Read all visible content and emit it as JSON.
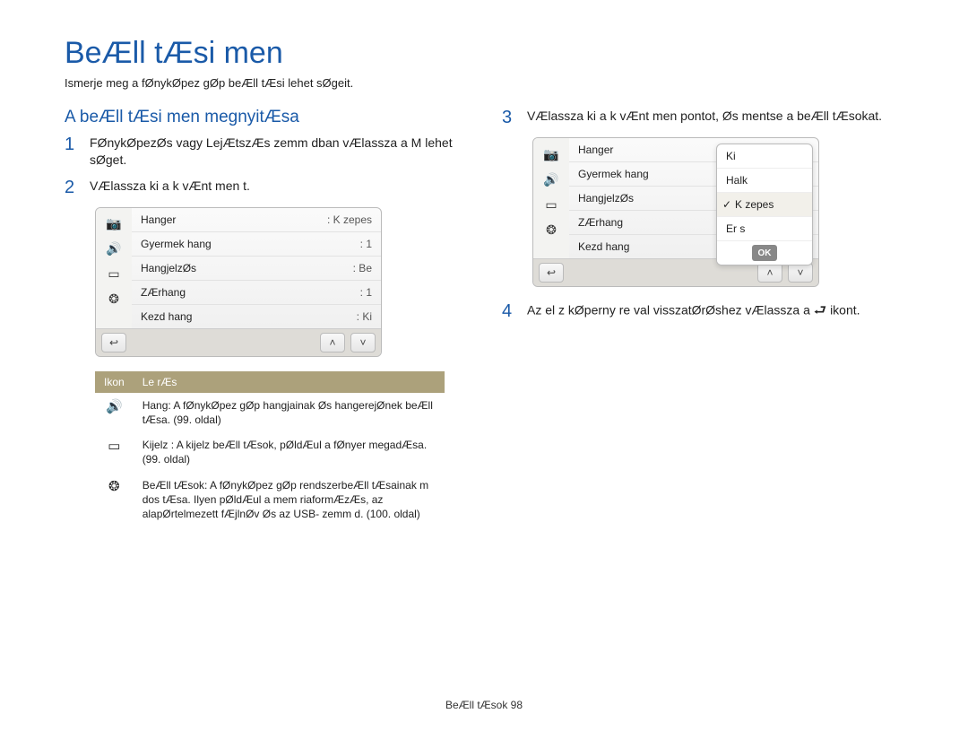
{
  "title": "BeÆll tÆsi men",
  "intro": "Ismerje meg a fØnykØpez gØp beÆll tÆsi lehet sØgeit.",
  "leftCol": {
    "subhead": "A beÆll tÆsi men  megnyitÆsa",
    "step1": "FØnykØpezØs vagy LejÆtszÆs  zemm dban vÆlassza a M      lehet sØget.",
    "step2": "VÆlassza ki a k vÆnt men t."
  },
  "screenA": {
    "rows": [
      {
        "label": "Hanger",
        "val": ": K zepes"
      },
      {
        "label": "Gyermek hang",
        "val": ": 1"
      },
      {
        "label": "HangjelzØs",
        "val": ": Be"
      },
      {
        "label": "ZÆrhang",
        "val": ": 1"
      },
      {
        "label": "Kezd hang",
        "val": ": Ki"
      }
    ]
  },
  "descTable": {
    "header": {
      "icon": "Ikon",
      "desc": "Le rÆs"
    },
    "rows": [
      {
        "icon": "🔊",
        "name": "sound-icon",
        "desc": "Hang: A fØnykØpez gØp hangjainak Øs hangerejØnek beÆll tÆsa. (99. oldal)"
      },
      {
        "icon": "▭",
        "name": "display-icon",
        "desc": "Kijelz : A kijelz  beÆll tÆsok, pØldÆul a fØnyer  megadÆsa. (99. oldal)"
      },
      {
        "icon": "❂",
        "name": "settings-icon",
        "desc": "BeÆll tÆsok: A fØnykØpez gØp rendszerbeÆll tÆsainak m dos tÆsa. Ilyen pØldÆul a mem riaformÆzÆs, az alapØrtelmezett fÆjlnØv Øs az USB- zemm d. (100. oldal)"
      }
    ]
  },
  "rightCol": {
    "step3": "VÆlassza ki a k vÆnt men pontot, Øs mentse a beÆll tÆsokat.",
    "step4_a": "Az el z  kØperny re val  visszatØrØshez vÆlassza a",
    "step4_b": "ikont."
  },
  "screenB": {
    "rows": [
      {
        "label": "Hanger"
      },
      {
        "label": "Gyermek hang"
      },
      {
        "label": "HangjelzØs"
      },
      {
        "label": "ZÆrhang"
      },
      {
        "label": "Kezd hang"
      }
    ],
    "popup": {
      "opts": [
        "Ki",
        "Halk",
        "K zepes",
        "Er s"
      ],
      "selected": 2,
      "ok": "OK"
    }
  },
  "footer": {
    "section": "BeÆll tÆsok",
    "page": "98"
  },
  "icons": {
    "camera": "📷",
    "sound": "🔊",
    "display": "▭",
    "gear": "❂",
    "back": "↩",
    "up": "˄",
    "down": "˅",
    "return": "⮐"
  }
}
